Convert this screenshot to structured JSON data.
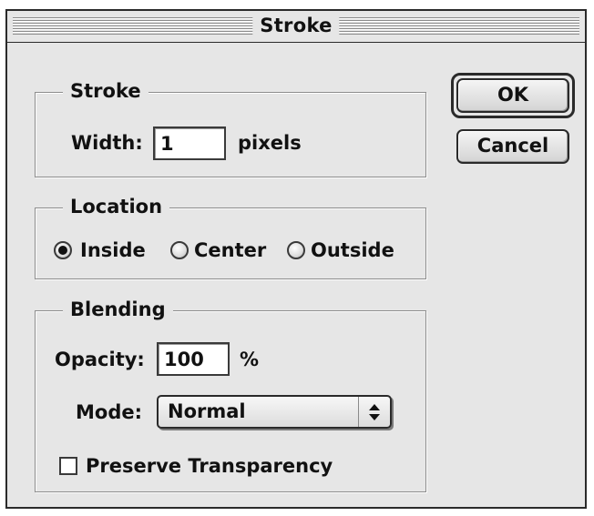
{
  "window": {
    "title": "Stroke"
  },
  "stroke": {
    "group_label": "Stroke",
    "width_label": "Width:",
    "width_value": "1",
    "unit_label": "pixels"
  },
  "location": {
    "group_label": "Location",
    "options": [
      "Inside",
      "Center",
      "Outside"
    ],
    "selected": "Inside"
  },
  "blending": {
    "group_label": "Blending",
    "opacity_label": "Opacity:",
    "opacity_value": "100",
    "opacity_unit": "%",
    "mode_label": "Mode:",
    "mode_value": "Normal",
    "preserve_label": "Preserve Transparency",
    "preserve_checked": false
  },
  "buttons": {
    "ok": "OK",
    "cancel": "Cancel"
  },
  "icons": {
    "radio_selected": "radio-filled-icon",
    "radio_empty": "radio-empty-icon",
    "select_arrows": "up-down-arrows-icon",
    "checkbox": "checkbox-empty-icon"
  },
  "colors": {
    "dialog_bg": "#e6e6e6",
    "border": "#2a2a2a",
    "field_bg": "#ffffff"
  }
}
